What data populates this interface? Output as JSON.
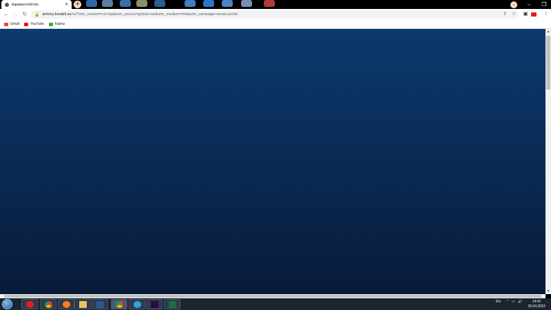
{
  "browser": {
    "tab": {
      "title": "Адмиралтейство"
    },
    "url": {
      "domain": "armory.korabli.su",
      "rest": "/ru/?utm_content=cm-top&utm_source=global-nav&utm_medium=link&utm_campaign=wows-portal"
    },
    "bookmarks": [
      {
        "label": "Gmail",
        "icon": "gmail-icon",
        "color": "#ea4335"
      },
      {
        "label": "YouTube",
        "icon": "youtube-icon",
        "color": "#ff0000"
      },
      {
        "label": "Карты",
        "icon": "maps-icon",
        "color": "#34a853"
      }
    ]
  },
  "page": {
    "background_top": "#0b3a6e",
    "background_bottom": "#081a38"
  },
  "taskbar": {
    "language": "RU",
    "time": "14:41",
    "date": "26.04.2023"
  }
}
